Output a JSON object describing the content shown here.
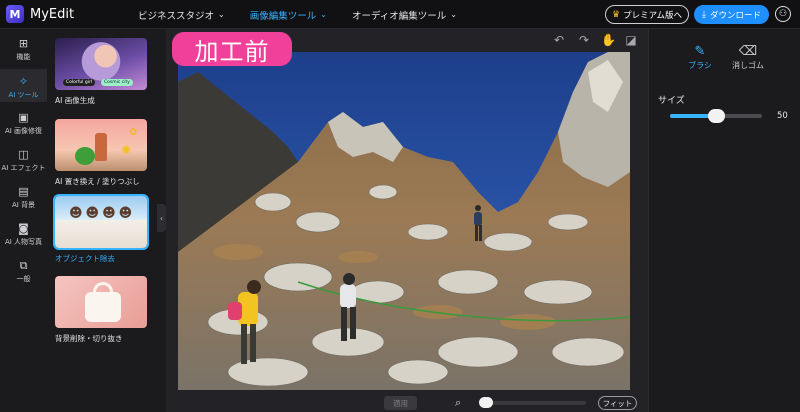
{
  "app": {
    "name": "MyEdit",
    "logo_letter": "M"
  },
  "nav": [
    {
      "label": "ビジネススタジオ",
      "active": false
    },
    {
      "label": "画像編集ツール",
      "active": true
    },
    {
      "label": "オーディオ編集ツール",
      "active": false
    }
  ],
  "header": {
    "premium_label": "プレミアム版へ",
    "download_label": "ダウンロード"
  },
  "rail": [
    {
      "icon": "grid-icon",
      "glyph": "⊞",
      "label": "機能"
    },
    {
      "icon": "magic-wand-icon",
      "glyph": "✧",
      "label": "AI ツール",
      "active": true
    },
    {
      "icon": "image-repair-icon",
      "glyph": "▣",
      "label": "AI 画像修復"
    },
    {
      "icon": "effect-icon",
      "glyph": "◫",
      "label": "AI エフェクト"
    },
    {
      "icon": "background-icon",
      "glyph": "▤",
      "label": "AI 背景"
    },
    {
      "icon": "portrait-icon",
      "glyph": "◙",
      "label": "AI 人物写真"
    },
    {
      "icon": "layers-icon",
      "glyph": "⧉",
      "label": "一般"
    }
  ],
  "thumbnails": [
    {
      "caption": "AI 画像生成",
      "chips": [
        "Colorful girl",
        "Cosmic city"
      ]
    },
    {
      "caption": "AI 置き換え / 塗りつぶし"
    },
    {
      "caption": "オブジェクト除去",
      "selected": true
    },
    {
      "caption": "背景削除・切り抜き"
    }
  ],
  "canvas": {
    "before_label": "加工前"
  },
  "bottom": {
    "apply_label": "適用",
    "fit_label": "フィット",
    "zoom": 0
  },
  "right_panel": {
    "tabs": [
      {
        "label": "ブラシ",
        "icon": "brush-icon",
        "glyph": "✎",
        "active": true
      },
      {
        "label": "消しゴム",
        "icon": "eraser-icon",
        "glyph": "⌫",
        "active": false
      }
    ],
    "size_label": "サイズ",
    "size_value": "50",
    "size_fraction": 0.5
  },
  "colors": {
    "accent": "#37b4ff",
    "before_badge": "#f0409a",
    "download": "#1f8fff"
  }
}
